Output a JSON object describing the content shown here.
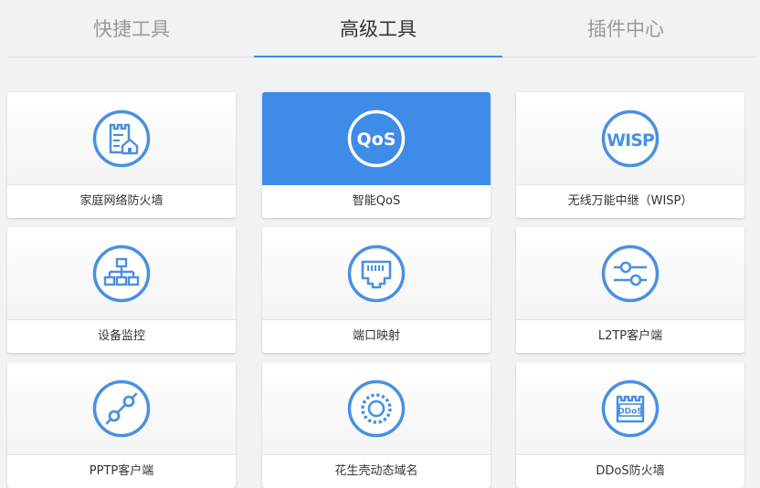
{
  "colors": {
    "accent": "#3f8ce8",
    "icon_blue": "#4a90e2",
    "tab_inactive": "#999999",
    "tab_active": "#333333"
  },
  "tabs": [
    {
      "label": "快捷工具",
      "active": false
    },
    {
      "label": "高级工具",
      "active": true
    },
    {
      "label": "插件中心",
      "active": false
    }
  ],
  "tools": [
    {
      "label": "家庭网络防火墙",
      "icon": "firewall-home-icon",
      "active": false
    },
    {
      "label": "智能QoS",
      "icon": "qos-icon",
      "icon_text": "QoS",
      "active": true
    },
    {
      "label": "无线万能中继（WISP）",
      "icon": "wisp-icon",
      "icon_text": "WISP",
      "active": false
    },
    {
      "label": "设备监控",
      "icon": "device-tree-icon",
      "active": false
    },
    {
      "label": "端口映射",
      "icon": "ethernet-port-icon",
      "active": false
    },
    {
      "label": "L2TP客户端",
      "icon": "sliders-icon",
      "active": false
    },
    {
      "label": "PPTP客户端",
      "icon": "link-nodes-icon",
      "active": false
    },
    {
      "label": "花生壳动态域名",
      "icon": "ring-dots-icon",
      "active": false
    },
    {
      "label": "DDoS防火墙",
      "icon": "ddos-firewall-icon",
      "icon_text": "DDoS",
      "active": false
    }
  ]
}
